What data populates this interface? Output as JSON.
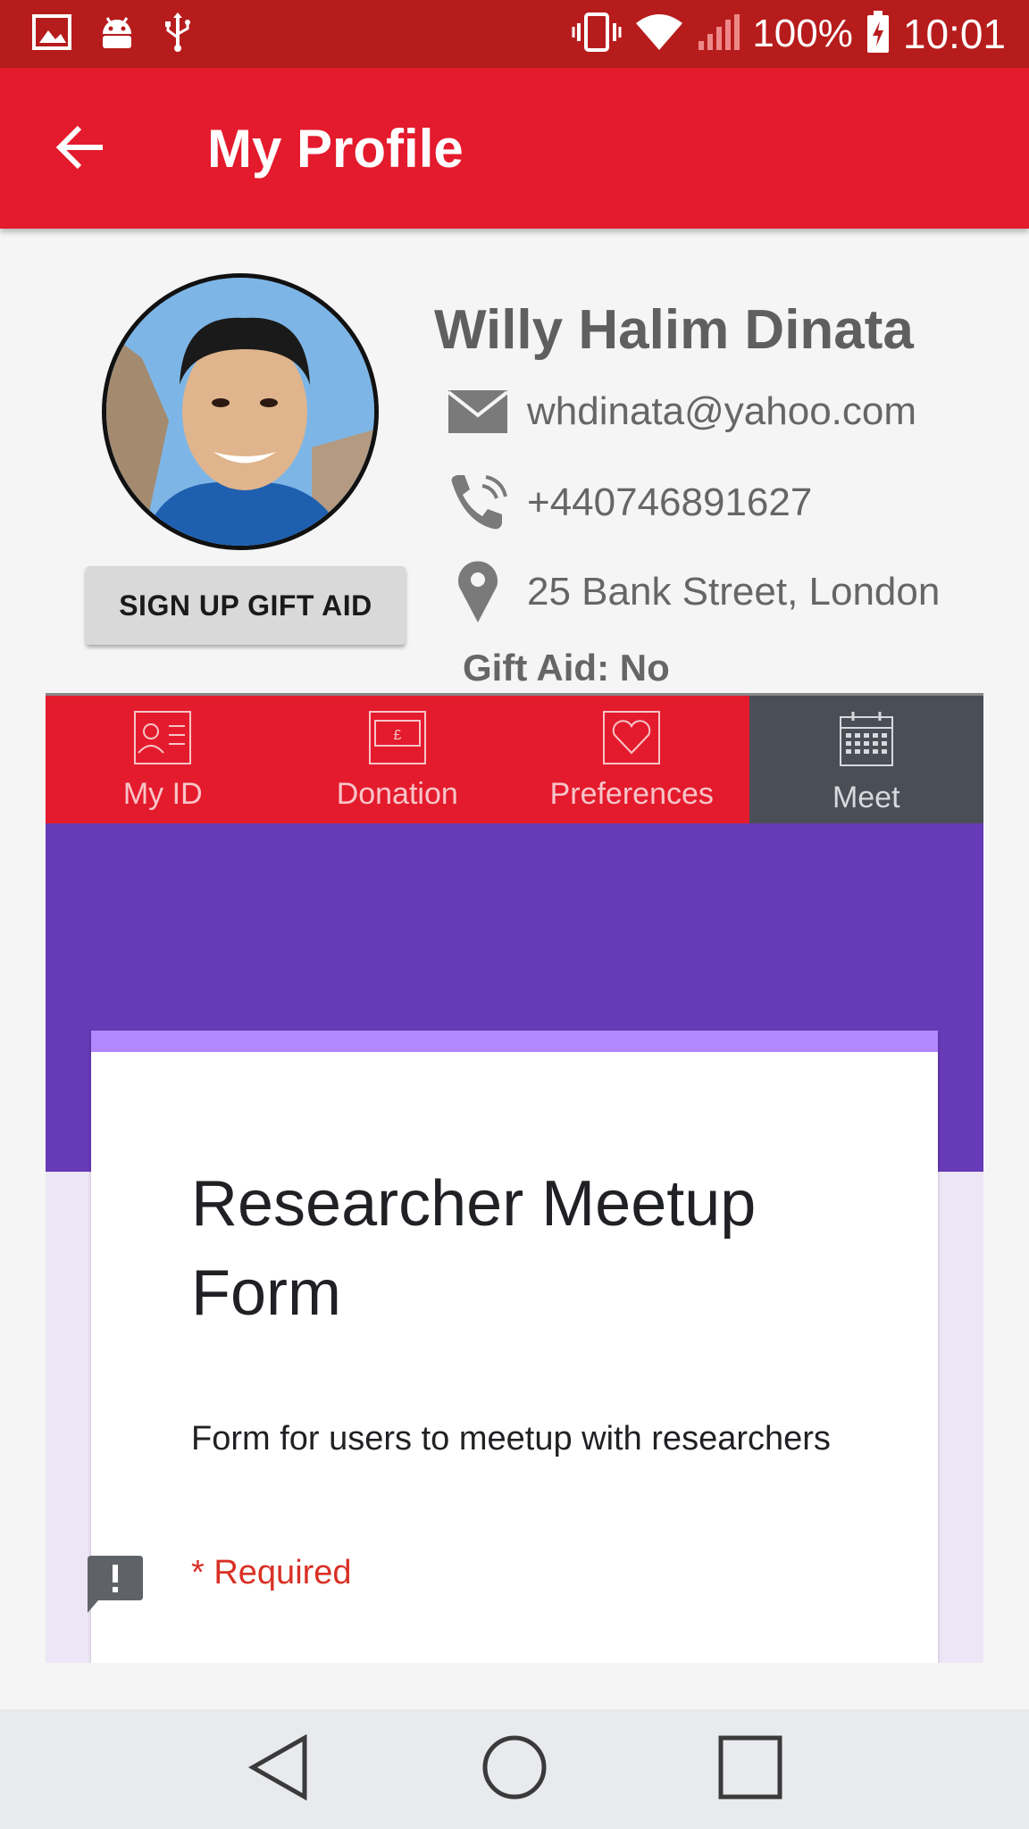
{
  "status_bar": {
    "battery": "100%",
    "time": "10:01",
    "left_icons": [
      "image-icon",
      "android-icon",
      "usb-icon"
    ],
    "right_icons": [
      "vibrate-icon",
      "wifi-icon",
      "signal-icon",
      "battery-charging-icon"
    ]
  },
  "app_bar": {
    "title": "My Profile",
    "back_icon": "arrow-left-icon"
  },
  "profile": {
    "name": "Willy Halim Dinata",
    "email": "whdinata@yahoo.com",
    "phone": "+440746891627",
    "address": "25 Bank Street, London",
    "gift_aid": "Gift Aid: No",
    "gift_aid_button": "SIGN UP GIFT AID"
  },
  "tabs": [
    {
      "label": "My ID",
      "icon": "id-card-icon",
      "active": false
    },
    {
      "label": "Donation",
      "icon": "banknote-icon",
      "active": false
    },
    {
      "label": "Preferences",
      "icon": "heart-icon",
      "active": false
    },
    {
      "label": "Meet",
      "icon": "calendar-icon",
      "active": true
    }
  ],
  "form": {
    "title": "Researcher Meetup Form",
    "description": "Form for users to meetup with researchers",
    "required": "* Required"
  },
  "colors": {
    "status_bar": "#b71c1c",
    "app_bar": "#e41b2d",
    "active_tab": "#4a4e57",
    "form_header": "#673ab7",
    "form_accent": "#b388ff",
    "required": "#d93025"
  },
  "nav": [
    "back-triangle-icon",
    "home-circle-icon",
    "recents-square-icon"
  ]
}
